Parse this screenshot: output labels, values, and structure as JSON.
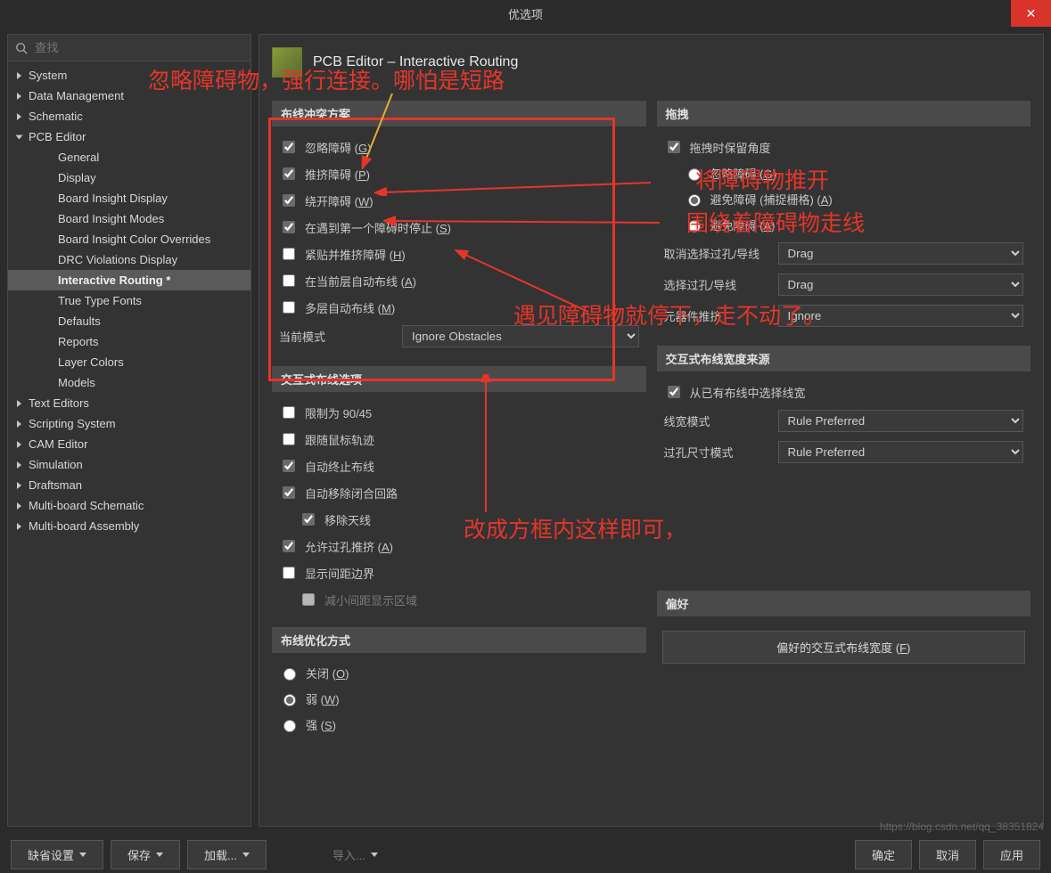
{
  "title": "优选项",
  "search_placeholder": "查找",
  "tree": [
    {
      "label": "System",
      "type": "parent"
    },
    {
      "label": "Data Management",
      "type": "parent"
    },
    {
      "label": "Schematic",
      "type": "parent"
    },
    {
      "label": "PCB Editor",
      "type": "parent",
      "expanded": true
    },
    {
      "label": "General",
      "type": "child"
    },
    {
      "label": "Display",
      "type": "child"
    },
    {
      "label": "Board Insight Display",
      "type": "child"
    },
    {
      "label": "Board Insight Modes",
      "type": "child"
    },
    {
      "label": "Board Insight Color Overrides",
      "type": "child"
    },
    {
      "label": "DRC Violations Display",
      "type": "child"
    },
    {
      "label": "Interactive Routing *",
      "type": "child",
      "active": true
    },
    {
      "label": "True Type Fonts",
      "type": "child"
    },
    {
      "label": "Defaults",
      "type": "child"
    },
    {
      "label": "Reports",
      "type": "child"
    },
    {
      "label": "Layer Colors",
      "type": "child"
    },
    {
      "label": "Models",
      "type": "child"
    },
    {
      "label": "Text Editors",
      "type": "parent"
    },
    {
      "label": "Scripting System",
      "type": "parent"
    },
    {
      "label": "CAM Editor",
      "type": "parent"
    },
    {
      "label": "Simulation",
      "type": "parent"
    },
    {
      "label": "Draftsman",
      "type": "parent"
    },
    {
      "label": "Multi-board Schematic",
      "type": "parent"
    },
    {
      "label": "Multi-board Assembly",
      "type": "parent"
    }
  ],
  "page_heading": "PCB Editor – Interactive Routing",
  "sections": {
    "conflict_header": "布线冲突方案",
    "ignore_obs": "忽略障碍 ",
    "ignore_obs_hk": "G",
    "push_obs": "推挤障碍 ",
    "push_obs_hk": "P",
    "walk_obs": "绕开障碍 ",
    "walk_obs_hk": "W",
    "stop_first": "在遇到第一个障碍时停止 ",
    "stop_first_hk": "S",
    "hug_push": "紧贴并推挤障碍 ",
    "hug_push_hk": "H",
    "auto_curr": "在当前层自动布线 ",
    "auto_curr_hk": "A",
    "auto_multi": "多层自动布线 ",
    "auto_multi_hk": "M",
    "current_mode_label": "当前模式",
    "current_mode_value": "Ignore Obstacles",
    "interactive_opts_header": "交互式布线选项",
    "limit9045": "限制为 90/45",
    "follow_mouse": "跟随鼠标轨迹",
    "auto_term": "自动终止布线",
    "auto_remove_loop": "自动移除闭合回路",
    "remove_ant": "移除天线",
    "allow_via_push": "允许过孔推挤 ",
    "allow_via_push_hk": "A",
    "show_clear": "显示间距边界",
    "reduce_disp": "减小间距显示区域",
    "opt_header": "布线优化方式",
    "opt_off": "关闭 ",
    "opt_off_hk": "O",
    "opt_weak": "弱 ",
    "opt_weak_hk": "W",
    "opt_strong": "强 ",
    "opt_strong_hk": "S",
    "drag_header": "拖拽",
    "keep_angle": "拖拽时保留角度",
    "d_ignore": "忽略障碍 ",
    "d_ignore_hk": "G",
    "d_avoid_snap": "避免障碍 (捕捉栅格) ",
    "d_avoid_snap_hk": "A",
    "d_avoid": "避免障碍 ",
    "d_avoid_hk": "A",
    "unsel_via_label": "取消选择过孔/导线",
    "unsel_via_value": "Drag",
    "sel_via_label": "选择过孔/导线",
    "sel_via_value": "Drag",
    "comp_push_label": "元器件推挤",
    "comp_push_value": "Ignore",
    "width_src_header": "交互式布线宽度来源",
    "from_existing": "从已有布线中选择线宽",
    "width_mode_label": "线宽模式",
    "width_mode_value": "Rule Preferred",
    "via_size_label": "过孔尺寸模式",
    "via_size_value": "Rule Preferred",
    "fav_header": "偏好",
    "fav_button": "偏好的交互式布线宽度 ",
    "fav_button_hk": "F"
  },
  "bottom": {
    "defaults": "缺省设置",
    "save": "保存",
    "load": "加载...",
    "import": "导入...",
    "ok": "确定",
    "cancel": "取消",
    "apply": "应用"
  },
  "annotations": {
    "a1": "忽略障碍物，强行连接。哪怕是短路",
    "a2": "将障碍物推开",
    "a3": "围绕着障碍物走线",
    "a4": "遇见障碍物就停下，走不动了。",
    "a5": "改成方框内这样即可，"
  },
  "watermark": "https://blog.csdn.net/qq_38351824"
}
